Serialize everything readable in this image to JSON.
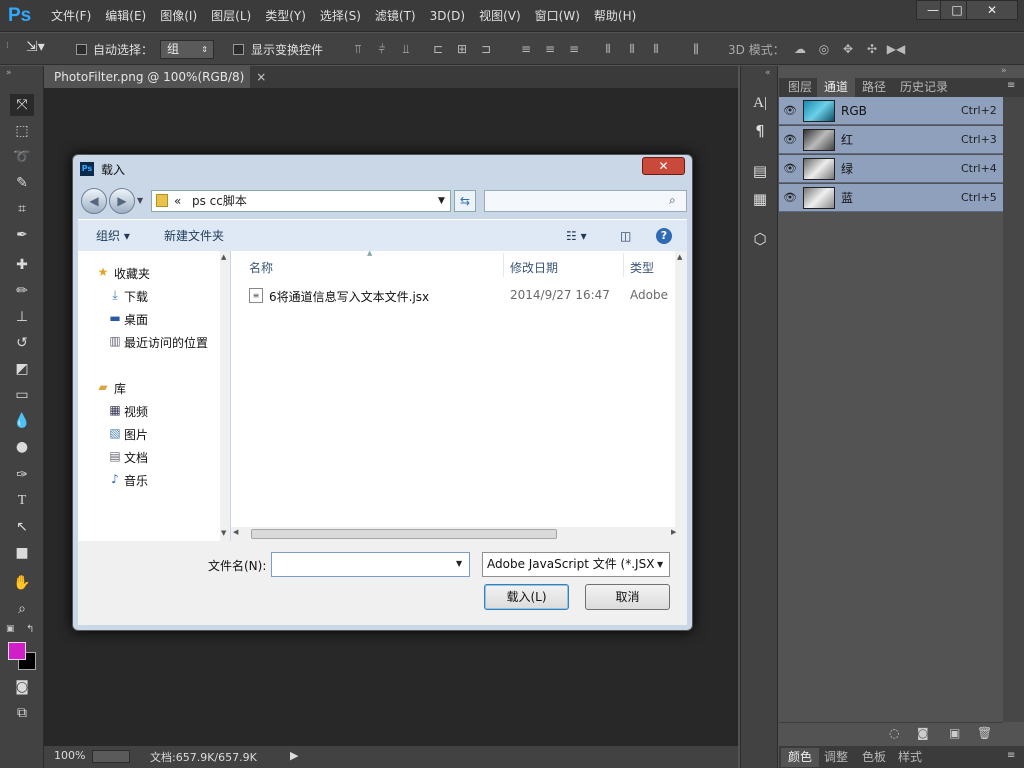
{
  "app": {
    "logo": "Ps"
  },
  "menu": [
    "文件(F)",
    "编辑(E)",
    "图像(I)",
    "图层(L)",
    "类型(Y)",
    "选择(S)",
    "滤镜(T)",
    "3D(D)",
    "视图(V)",
    "窗口(W)",
    "帮助(H)"
  ],
  "window_buttons": {
    "minimize": "—",
    "restore": "□",
    "close": "✕"
  },
  "options": {
    "auto_select_label": "自动选择：",
    "auto_select_value": "组",
    "show_transform_label": "显示变换控件",
    "mode_3d_label": "3D 模式："
  },
  "document": {
    "tab_label": "PhotoFilter.png @ 100%(RGB/8)",
    "tab_close": "×"
  },
  "status": {
    "zoom": "100%",
    "doc_info": "文档:657.9K/657.9K"
  },
  "panel": {
    "tabs": [
      "图层",
      "通道",
      "路径",
      "历史记录"
    ],
    "active_tab": "通道",
    "channels": [
      {
        "name": "RGB",
        "shortcut": "Ctrl+2"
      },
      {
        "name": "红",
        "shortcut": "Ctrl+3"
      },
      {
        "name": "绿",
        "shortcut": "Ctrl+4"
      },
      {
        "name": "蓝",
        "shortcut": "Ctrl+5"
      }
    ],
    "bottom_tabs": [
      "颜色",
      "调整",
      "色板",
      "样式"
    ]
  },
  "dialog": {
    "title": "载入",
    "close": "✕",
    "address_prefix": "«",
    "address": "ps cc脚本",
    "organize": "组织",
    "new_folder": "新建文件夹",
    "favorites": {
      "header": "收藏夹",
      "items": [
        "下载",
        "桌面",
        "最近访问的位置"
      ]
    },
    "libraries": {
      "header": "库",
      "items": [
        "视频",
        "图片",
        "文档",
        "音乐"
      ]
    },
    "columns": {
      "name": "名称",
      "modified": "修改日期",
      "type": "类型"
    },
    "files": [
      {
        "name": "6将通道信息写入文本文件.jsx",
        "modified": "2014/9/27 16:47",
        "type": "Adobe"
      }
    ],
    "filename_label": "文件名(N):",
    "filename_value": "",
    "filetype": "Adobe JavaScript 文件 (*.JSX",
    "load_button": "载入(L)",
    "cancel_button": "取消"
  },
  "colors": {
    "foreground": "#d21ec8",
    "background": "#000000",
    "selection": "#8fa0bd"
  }
}
